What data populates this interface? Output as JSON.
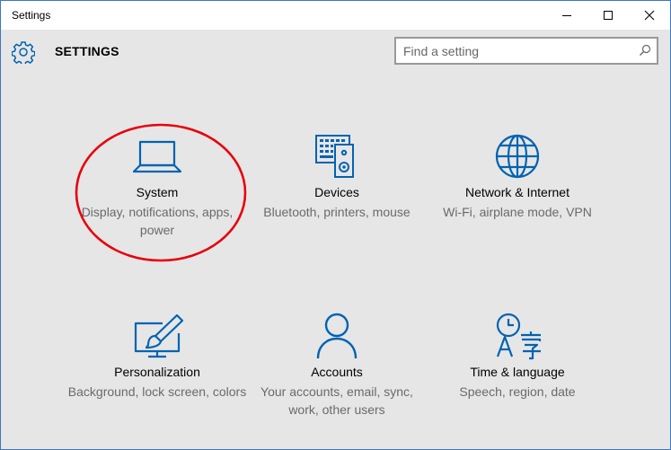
{
  "window": {
    "title": "Settings"
  },
  "header": {
    "title": "SETTINGS",
    "icon": "gear-icon"
  },
  "search": {
    "placeholder": "Find a setting",
    "value": "",
    "icon": "search-icon"
  },
  "tiles": [
    {
      "name": "System",
      "desc": "Display, notifications, apps, power",
      "icon": "laptop-icon"
    },
    {
      "name": "Devices",
      "desc": "Bluetooth, printers, mouse",
      "icon": "devices-icon"
    },
    {
      "name": "Network & Internet",
      "desc": "Wi-Fi, airplane mode, VPN",
      "icon": "globe-icon"
    },
    {
      "name": "Personalization",
      "desc": "Background, lock screen, colors",
      "icon": "paintbrush-icon"
    },
    {
      "name": "Accounts",
      "desc": "Your accounts, email, sync, work, other users",
      "icon": "person-icon"
    },
    {
      "name": "Time & language",
      "desc": "Speech, region, date",
      "icon": "clock-language-icon"
    }
  ],
  "colors": {
    "accent": "#0063b1",
    "annotation": "#e8000b",
    "background": "#e6e6e6",
    "title_bar": "#ffffff",
    "window_border": "#3c78c3"
  }
}
